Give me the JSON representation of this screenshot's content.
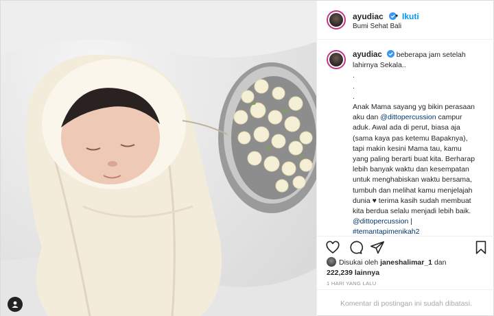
{
  "post": {
    "username": "ayudiac",
    "follow_label": "Ikuti",
    "separator": "•",
    "location": "Bumi Sehat Bali"
  },
  "caption": {
    "username": "ayudiac",
    "lines": [
      "beberapa jam setelah",
      "lahirnya Sekala..",
      ".",
      ".",
      ".",
      "Anak Mama sayang yg bikin perasaan",
      "aku dan ",
      " campur",
      "aduk. Awal ada di perut, biasa aja",
      "(sama kaya pas ketemu Bapaknya),",
      "tapi makin kesini Mama tau, kamu",
      "yang paling berarti buat kita. Berharap",
      "lebih banyak waktu dan kesempatan",
      "untuk menghabiskan waktu bersama,",
      "tumbuh dan melihat kamu menjelajah",
      "dunia ♥ terima kasih sudah membuat",
      "kita berdua selalu menjadi lebih baik.",
      "@dittopercussion",
      " |",
      "#temantapimenikah2"
    ],
    "mention": "@dittopercussion"
  },
  "likes": {
    "prefix": "Disukai oleh",
    "user": "janeshalimar_1",
    "conj": "dan",
    "count": "222,239 lainnya"
  },
  "time_ago": "1 HARI YANG LALU",
  "comment_notice": "Komentar di postingan ini sudah dibatasi.",
  "icons": {
    "verified": "verified-badge-icon",
    "like": "heart-icon",
    "comment": "comment-icon",
    "share": "share-icon",
    "save": "bookmark-icon",
    "tag": "user-tag-icon"
  },
  "colors": {
    "link": "#00376b",
    "follow": "#0095f6",
    "verified": "#3897f0",
    "border": "#dbdbdb"
  }
}
